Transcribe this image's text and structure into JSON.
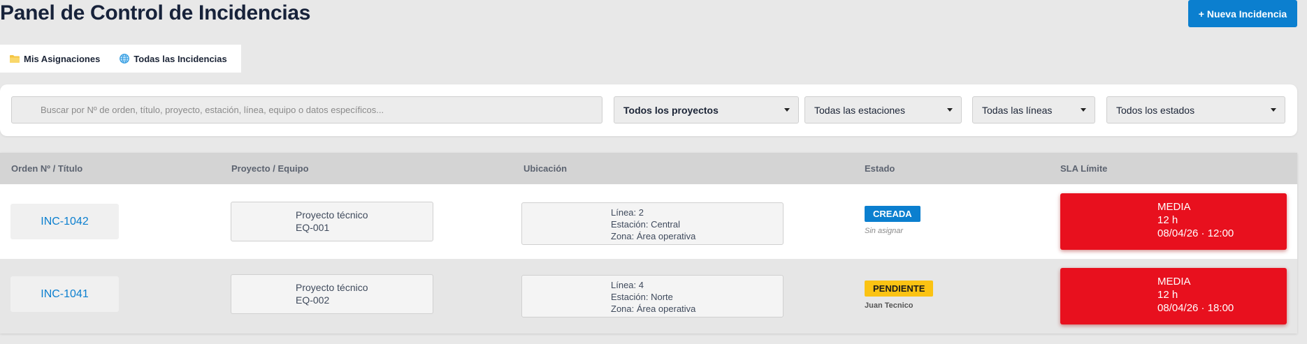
{
  "header": {
    "title": "Panel de Control de Incidencias",
    "new_button": "+ Nueva Incidencia"
  },
  "tabs": [
    {
      "label": "Mis Asignaciones",
      "icon": "folder-icon",
      "icon_color": "#f5c542"
    },
    {
      "label": "Todas las Incidencias",
      "icon": "globe-icon",
      "icon_color": "#2f9ae0"
    }
  ],
  "filters": {
    "search_placeholder": "Buscar por Nº de orden, título, proyecto, estación, línea, equipo o datos específicos...",
    "project": "Todos los proyectos",
    "station": "Todas las estaciones",
    "line": "Todas las líneas",
    "status": "Todos los estados"
  },
  "table": {
    "columns": [
      "Orden Nº / Título",
      "Proyecto / Equipo",
      "Ubicación",
      "Estado",
      "SLA Límite"
    ],
    "rows": [
      {
        "order": "INC-1042",
        "project": "Proyecto técnico",
        "equipment": "EQ-001",
        "line": "Línea: 2",
        "station": "Estación: Central",
        "zone": "Zona: Área operativa",
        "status": "CREADA",
        "status_color": "#0b7fcf",
        "assignee": "Sin asignar",
        "sla_priority": "MEDIA",
        "sla_hours": "12 h",
        "sla_deadline": "08/04/26 · 12:00",
        "sla_color": "#e8101e"
      },
      {
        "order": "INC-1041",
        "project": "Proyecto técnico",
        "equipment": "EQ-002",
        "line": "Línea: 4",
        "station": "Estación: Norte",
        "zone": "Zona: Área operativa",
        "status": "PENDIENTE",
        "status_color": "#fbc313",
        "assignee": "Juan Tecnico",
        "sla_priority": "MEDIA",
        "sla_hours": "12 h",
        "sla_deadline": "08/04/26 · 18:00",
        "sla_color": "#e8101e"
      }
    ]
  },
  "colors": {
    "accent": "#0b7fcf",
    "background": "#e8e8e8"
  }
}
